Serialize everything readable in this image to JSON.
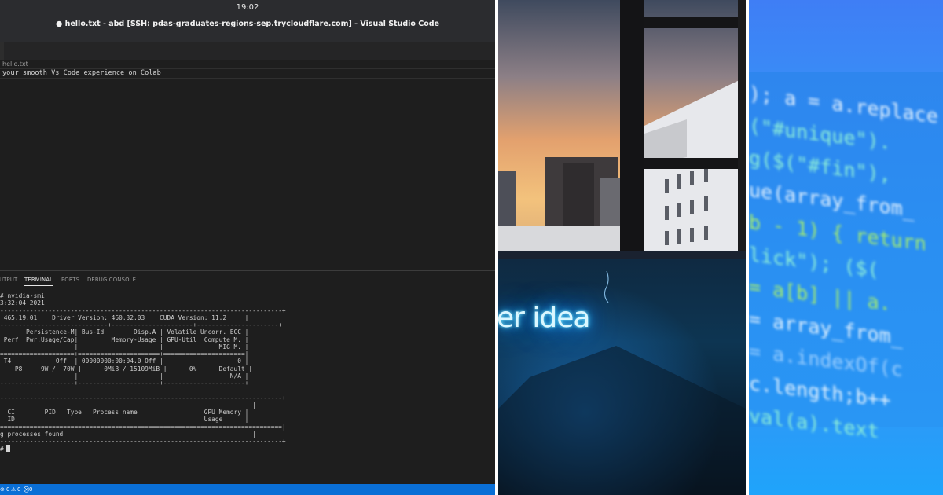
{
  "vscode": {
    "clock": "19:02",
    "window_title": "● hello.txt - abd [SSH: pdas-graduates-regions-sep.trycloudflare.com] - Visual Studio Code",
    "breadcrumb": "hello.txt",
    "editor_line": "your smooth Vs Code experience on Colab",
    "panel_tabs": [
      "UTPUT",
      "TERMINAL",
      "PORTS",
      "DEBUG CONSOLE"
    ],
    "active_panel_tab": "TERMINAL",
    "terminal_lines": [
      "# nvidia-smi",
      "3:32:04 2021",
      "----------------------------------------------------------------------------+",
      " 465.19.01    Driver Version: 460.32.03    CUDA Version: 11.2     |",
      "-----------------------------+----------------------+----------------------+",
      "       Persistence-M| Bus-Id        Disp.A | Volatile Uncorr. ECC |",
      " Perf  Pwr:Usage/Cap|         Memory-Usage | GPU-Util  Compute M. |",
      "                    |                      |               MIG M. |",
      "====================+======================+======================|",
      " T4            Off  | 00000000:00:04.0 Off |                    0 |",
      "    P8     9W /  70W |      0MiB / 15109MiB |      0%      Default |",
      "                    |                      |                  N/A |",
      "--------------------+----------------------+----------------------+",
      "",
      "----------------------------------------------------------------------------+",
      "                                                                    |",
      "  CI        PID   Type   Process name                  GPU Memory |",
      "  ID                                                   Usage      |",
      "============================================================================|",
      "g processes found                                                   |",
      "----------------------------------------------------------------------------+",
      "#"
    ],
    "status": {
      "errors": "0",
      "warnings": "0",
      "ports": "0"
    }
  },
  "photo": {
    "neon_text": "er idea"
  },
  "code_image": {
    "lines": [
      [
        "); a = a.replace",
        "c-w"
      ],
      [
        "(\"#unique\").",
        "c-c"
      ],
      [
        "g($(\"#fin\"),",
        "c-c"
      ],
      [
        "ue(array_from_",
        "c-w"
      ],
      [
        "b - 1) { return",
        "c-g"
      ],
      [
        "lick\"); ($(",
        "c-c"
      ],
      [
        "= a[b] || a.",
        "c-g"
      ],
      [
        "= array_from_",
        "c-w"
      ],
      [
        "= a.indexOf(c",
        "c-b"
      ],
      [
        "c.length;b++",
        "c-w"
      ],
      [
        "val(a).text",
        "c-c"
      ]
    ]
  }
}
